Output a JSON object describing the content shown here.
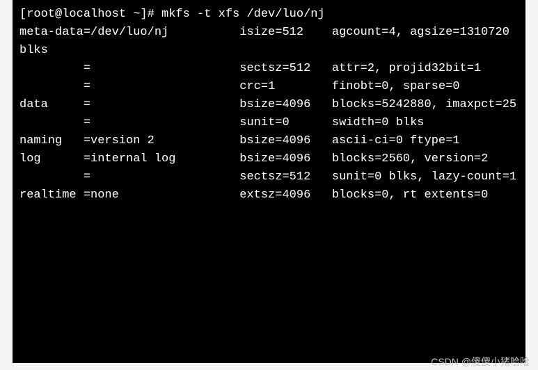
{
  "terminal": {
    "lines": [
      "[root@localhost ~]# mkfs -t xfs /dev/luo/nj",
      "meta-data=/dev/luo/nj          isize=512    agcount=4, agsize=1310720 blks",
      "         =                     sectsz=512   attr=2, projid32bit=1",
      "         =                     crc=1        finobt=0, sparse=0",
      "data     =                     bsize=4096   blocks=5242880, imaxpct=25",
      "         =                     sunit=0      swidth=0 blks",
      "naming   =version 2            bsize=4096   ascii-ci=0 ftype=1",
      "log      =internal log         bsize=4096   blocks=2560, version=2",
      "         =                     sectsz=512   sunit=0 blks, lazy-count=1",
      "realtime =none                 extsz=4096   blocks=0, rt extents=0"
    ]
  },
  "watermark": "CSDN @傻傻小猪哈哈"
}
